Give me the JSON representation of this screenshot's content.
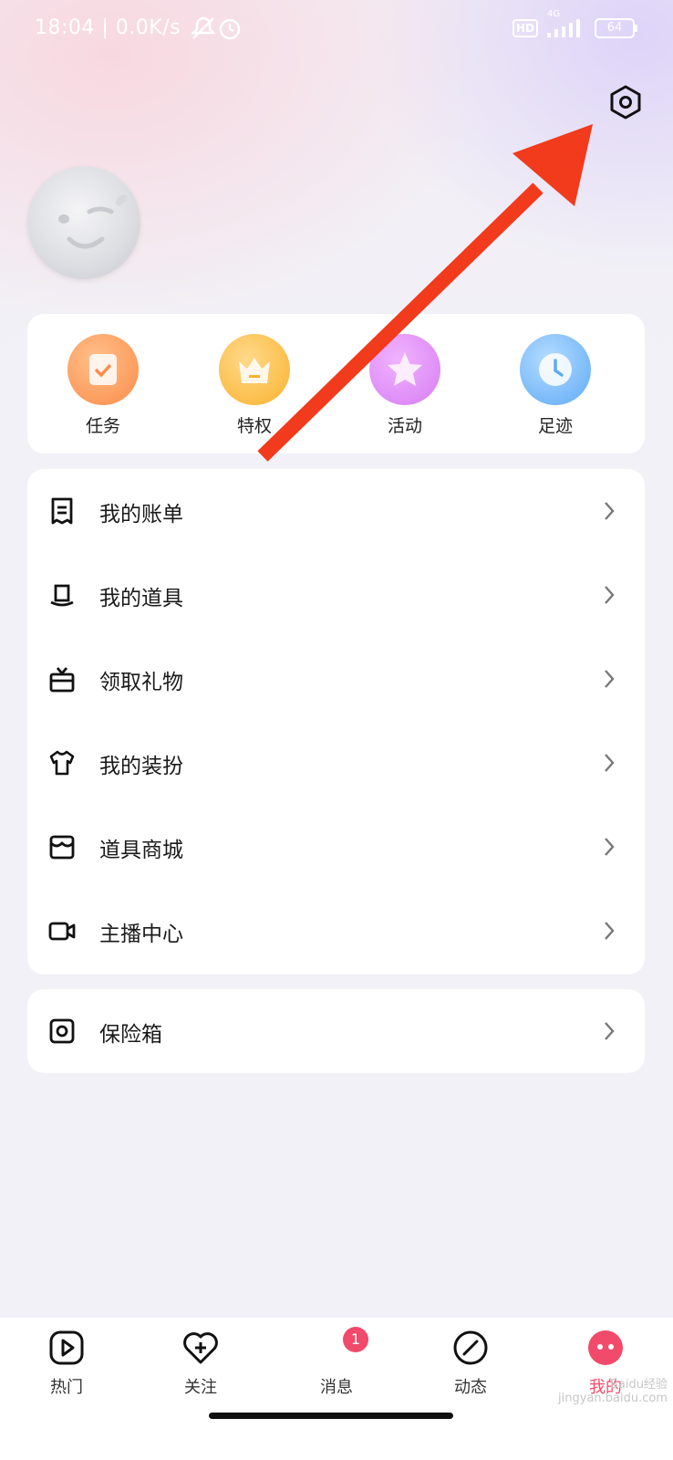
{
  "status_bar": {
    "time_speed": "18:04 | 0.0K/s",
    "network": "4G",
    "hd": "HD",
    "battery": "64"
  },
  "header": {
    "settings_icon": "hexagon-gear-icon"
  },
  "quick_actions": [
    {
      "label": "任务",
      "icon": "task-clipboard-icon",
      "color": "#fb8c4a"
    },
    {
      "label": "特权",
      "icon": "crown-icon",
      "color": "#f9b22e"
    },
    {
      "label": "活动",
      "icon": "star-icon",
      "color": "#d77ef2"
    },
    {
      "label": "足迹",
      "icon": "clock-icon",
      "color": "#5faaf6"
    }
  ],
  "menu": [
    {
      "label": "我的账单",
      "icon": "receipt-icon"
    },
    {
      "label": "我的道具",
      "icon": "hat-icon"
    },
    {
      "label": "领取礼物",
      "icon": "gift-icon"
    },
    {
      "label": "我的装扮",
      "icon": "tshirt-icon"
    },
    {
      "label": "道具商城",
      "icon": "store-icon"
    },
    {
      "label": "主播中心",
      "icon": "video-camera-icon"
    }
  ],
  "safe_box": {
    "label": "保险箱",
    "icon": "safe-icon"
  },
  "tabbar": [
    {
      "label": "热门",
      "icon": "play-icon"
    },
    {
      "label": "关注",
      "icon": "heart-plus-icon"
    },
    {
      "label": "消息",
      "icon": "message-icon",
      "badge": "1"
    },
    {
      "label": "动态",
      "icon": "slash-circle-icon"
    },
    {
      "label": "我的",
      "icon": "face-icon",
      "active_color": "#f24a6a"
    }
  ],
  "watermark": "Baidu经验 jingyan.baidu.com"
}
